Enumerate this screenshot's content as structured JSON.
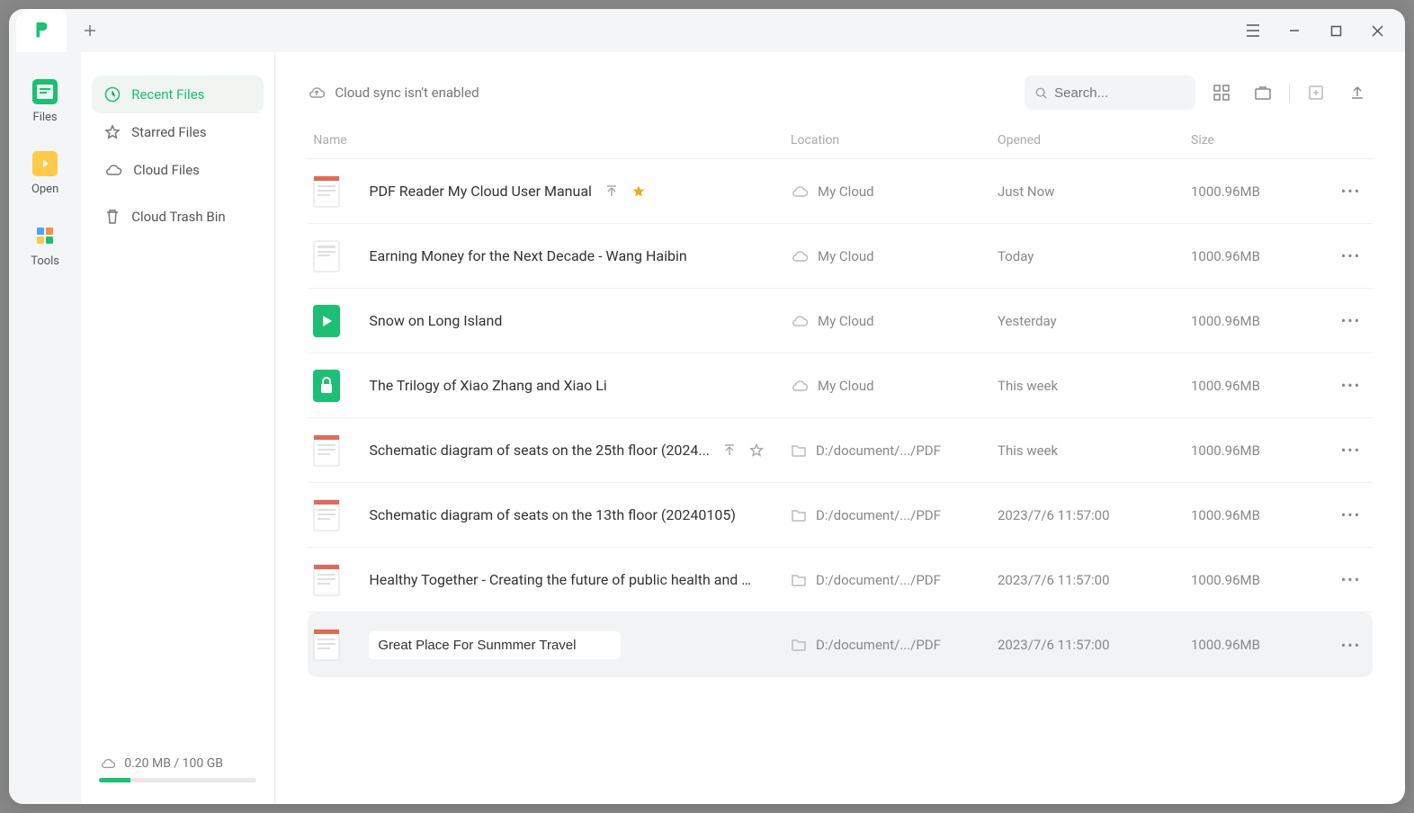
{
  "rail": {
    "items": [
      {
        "label": "Files"
      },
      {
        "label": "Open"
      },
      {
        "label": "Tools"
      }
    ]
  },
  "sidebar": {
    "items": [
      {
        "label": "Recent Files"
      },
      {
        "label": "Starred Files"
      },
      {
        "label": "Cloud Files"
      },
      {
        "label": "Cloud Trash Bin"
      }
    ],
    "storage": "0.20 MB / 100 GB"
  },
  "header": {
    "sync_msg": "Cloud sync isn't enabled",
    "search_placeholder": "Search..."
  },
  "table": {
    "columns": {
      "name": "Name",
      "location": "Location",
      "opened": "Opened",
      "size": "Size"
    },
    "rows": [
      {
        "name": "PDF Reader My Cloud User Manual",
        "location_icon": "cloud",
        "location": "My Cloud",
        "opened": "Just Now",
        "size": "1000.96MB",
        "show_actions": true,
        "starred": true,
        "editing": false,
        "thumb": "pdf"
      },
      {
        "name": "Earning Money for the Next Decade - Wang Haibin",
        "location_icon": "cloud",
        "location": "My Cloud",
        "opened": "Today",
        "size": "1000.96MB",
        "show_actions": false,
        "starred": false,
        "editing": false,
        "thumb": "doc"
      },
      {
        "name": "Snow on Long Island",
        "location_icon": "cloud",
        "location": "My Cloud",
        "opened": "Yesterday",
        "size": "1000.96MB",
        "show_actions": false,
        "starred": false,
        "editing": false,
        "thumb": "green"
      },
      {
        "name": "The Trilogy of Xiao Zhang and Xiao Li",
        "location_icon": "cloud",
        "location": "My Cloud",
        "opened": "This week",
        "size": "1000.96MB",
        "show_actions": false,
        "starred": false,
        "editing": false,
        "thumb": "lock"
      },
      {
        "name": "Schematic diagram of seats on the 25th floor (2024...",
        "location_icon": "folder",
        "location": "D:/document/.../PDF",
        "opened": "This week",
        "size": "1000.96MB",
        "show_actions": true,
        "starred": false,
        "editing": false,
        "thumb": "pdf"
      },
      {
        "name": "Schematic diagram of seats on the 13th floor (20240105)",
        "location_icon": "folder",
        "location": "D:/document/.../PDF",
        "opened": "2023/7/6 11:57:00",
        "size": "1000.96MB",
        "show_actions": false,
        "starred": false,
        "editing": false,
        "thumb": "pdf"
      },
      {
        "name": "Healthy Together - Creating the future of public health and h...",
        "location_icon": "folder",
        "location": "D:/document/.../PDF",
        "opened": "2023/7/6 11:57:00",
        "size": "1000.96MB",
        "show_actions": false,
        "starred": false,
        "editing": false,
        "thumb": "pdf"
      },
      {
        "name": "Great Place For Sunmmer Travel",
        "location_icon": "folder",
        "location": "D:/document/.../PDF",
        "opened": "2023/7/6 11:57:00",
        "size": "1000.96MB",
        "show_actions": false,
        "starred": false,
        "editing": true,
        "thumb": "pdf"
      }
    ]
  }
}
